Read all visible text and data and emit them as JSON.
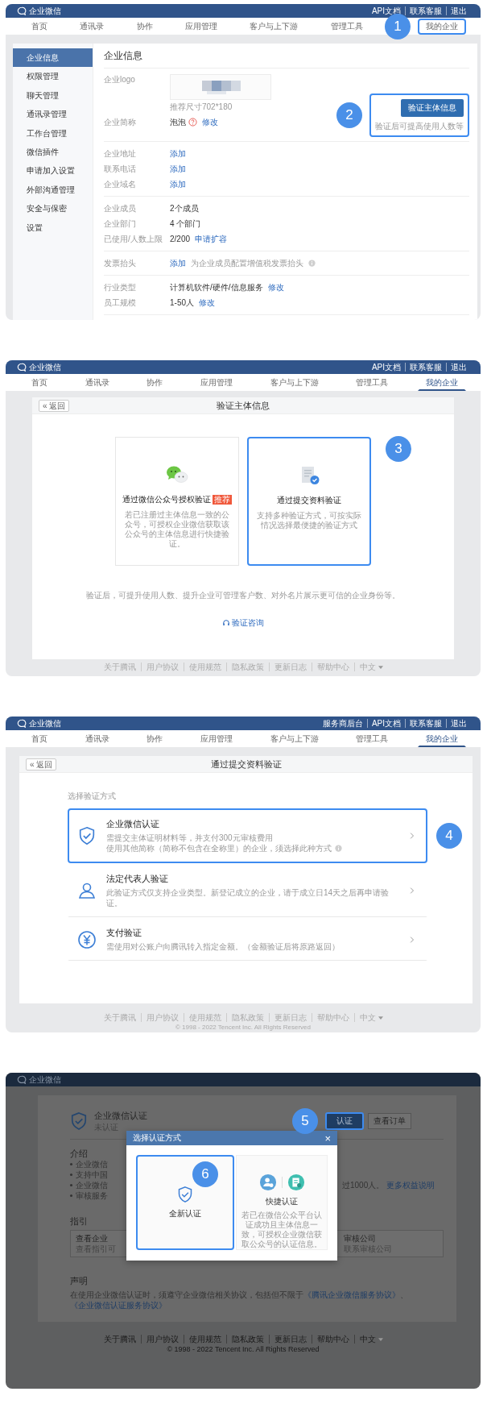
{
  "screens": [
    {
      "kind": "company_info",
      "brand": "企业微信",
      "top_links": [
        "API文档",
        "联系客服",
        "退出"
      ],
      "nav": [
        {
          "label": "首页",
          "selected": false,
          "highlighted": false
        },
        {
          "label": "通讯录",
          "selected": false,
          "highlighted": false
        },
        {
          "label": "协作",
          "selected": false,
          "highlighted": false
        },
        {
          "label": "应用管理",
          "selected": false,
          "highlighted": false
        },
        {
          "label": "客户与上下游",
          "selected": false,
          "highlighted": false
        },
        {
          "label": "管理工具",
          "selected": false,
          "highlighted": false
        },
        {
          "label": "我的企业",
          "selected": false,
          "highlighted": true,
          "step": "1"
        }
      ],
      "sidebar": [
        {
          "label": "企业信息",
          "selected": true
        },
        {
          "label": "权限管理",
          "selected": false
        },
        {
          "label": "聊天管理",
          "selected": false
        },
        {
          "label": "通讯录管理",
          "selected": false
        },
        {
          "label": "工作台管理",
          "selected": false
        },
        {
          "label": "微信插件",
          "selected": false
        },
        {
          "label": "申请加入设置",
          "selected": false
        },
        {
          "label": "外部沟通管理",
          "selected": false
        },
        {
          "label": "安全与保密",
          "selected": false
        },
        {
          "label": "设置",
          "selected": false
        }
      ],
      "title": "企业信息",
      "logo": {
        "label": "企业logo",
        "hint": "推荐尺寸702*180"
      },
      "short_name": {
        "label": "企业简称",
        "value": "泡泡",
        "link": "修改"
      },
      "verify": {
        "button": "验证主体信息",
        "note": "验证后可提高使用人数等",
        "highlighted": true,
        "step": "2"
      },
      "field_groups": [
        {
          "rows": [
            {
              "label": "企业地址",
              "link": "添加"
            },
            {
              "label": "联系电话",
              "link": "添加"
            },
            {
              "label": "企业域名",
              "link": "添加"
            }
          ]
        },
        {
          "rows": [
            {
              "label": "企业成员",
              "value": "2个成员"
            },
            {
              "label": "企业部门",
              "value": "4 个部门"
            },
            {
              "label": "已使用/人数上限",
              "value": "2/200",
              "link": "申请扩容"
            }
          ]
        },
        {
          "rows": [
            {
              "label": "发票抬头",
              "link": "添加",
              "note": "为企业成员配置增值税发票抬头"
            }
          ]
        },
        {
          "rows": [
            {
              "label": "行业类型",
              "value": "计算机软件/硬件/信息服务",
              "link": "修改"
            },
            {
              "label": "员工规模",
              "value": "1-50人",
              "link": "修改"
            }
          ]
        }
      ]
    },
    {
      "kind": "choose_verification",
      "brand": "企业微信",
      "top_links": [
        "API文档",
        "联系客服",
        "退出"
      ],
      "nav": [
        {
          "label": "首页",
          "selected": false,
          "highlighted": false
        },
        {
          "label": "通讯录",
          "selected": false,
          "highlighted": false
        },
        {
          "label": "协作",
          "selected": false,
          "highlighted": false
        },
        {
          "label": "应用管理",
          "selected": false,
          "highlighted": false
        },
        {
          "label": "客户与上下游",
          "selected": false,
          "highlighted": false
        },
        {
          "label": "管理工具",
          "selected": false,
          "highlighted": false
        },
        {
          "label": "我的企业",
          "selected": true,
          "highlighted": false
        }
      ],
      "back": "« 返回",
      "title": "验证主体信息",
      "options": [
        {
          "kind": "wechat",
          "title": "通过微信公众号授权验证",
          "tag": "推荐",
          "description": "若已注册过主体信息一致的公众号，可授权企业微信获取该公众号的主体信息进行快捷验证。",
          "highlighted": false
        },
        {
          "kind": "document",
          "title": "通过提交资料验证",
          "description": "支持多种验证方式，可按实际情况选择最便捷的验证方式",
          "highlighted": true,
          "step": "3"
        }
      ],
      "note": "验证后，可提升使用人数、提升企业可管理客户数、对外名片展示更可信的企业身份等。",
      "consult_link": "验证咨询",
      "footer_links": [
        "关于腾讯",
        "用户协议",
        "使用规范",
        "隐私政策",
        "更新日志",
        "帮助中心"
      ],
      "language": "中文"
    },
    {
      "kind": "choose_method",
      "brand": "企业微信",
      "top_links": [
        "服务商后台",
        "API文档",
        "联系客服",
        "退出"
      ],
      "nav": [
        {
          "label": "首页",
          "selected": false,
          "highlighted": false
        },
        {
          "label": "通讯录",
          "selected": false,
          "highlighted": false
        },
        {
          "label": "协作",
          "selected": false,
          "highlighted": false
        },
        {
          "label": "应用管理",
          "selected": false,
          "highlighted": false
        },
        {
          "label": "客户与上下游",
          "selected": false,
          "highlighted": false
        },
        {
          "label": "管理工具",
          "selected": false,
          "highlighted": false
        },
        {
          "label": "我的企业",
          "selected": true,
          "highlighted": false
        }
      ],
      "back": "« 返回",
      "title": "通过提交资料验证",
      "section_label": "选择验证方式",
      "methods": [
        {
          "kind": "shield",
          "title": "企业微信认证",
          "lines": [
            "需提交主体证明材料等，并支付300元审核费用",
            "使用其他简称（简称不包含在全称里）的企业，须选择此种方式"
          ],
          "info": true,
          "highlighted": true,
          "step": "4"
        },
        {
          "kind": "person",
          "title": "法定代表人验证",
          "lines": [
            "此验证方式仅支持企业类型。新登记成立的企业，请于成立日14天之后再申请验证。"
          ],
          "info": false,
          "highlighted": false
        },
        {
          "kind": "yuan",
          "title": "支付验证",
          "lines": [
            "需使用对公账户向腾讯转入指定金额。（金额验证后将原路返回）"
          ],
          "info": false,
          "highlighted": false
        }
      ],
      "footer_links": [
        "关于腾讯",
        "用户协议",
        "使用规范",
        "隐私政策",
        "更新日志",
        "帮助中心"
      ],
      "language": "中文",
      "copyright": "© 1998 - 2022 Tencent Inc. All Rights Reserved"
    },
    {
      "kind": "certification",
      "brand": "企业微信",
      "title": "企业微信认证",
      "status": "未认证",
      "action": {
        "label": "认证",
        "highlighted": true,
        "step": "5"
      },
      "orders_button": "查看订单",
      "intro": {
        "heading": "介绍",
        "bullets": [
          {
            "text": "企业微信"
          },
          {
            "text": "支持中国"
          },
          {
            "text": "企业微信",
            "tail": "过1000人。",
            "tail_link": "更多权益说明"
          },
          {
            "text": "审核服务"
          }
        ]
      },
      "guide": {
        "heading": "指引",
        "cards": [
          {
            "title": "查看企业",
            "text": "查看指引可"
          },
          {
            "title": "审核公司",
            "text": "联系审核公司"
          }
        ]
      },
      "statement": {
        "heading": "声明",
        "text": "在使用企业微信认证时，须遵守企业微信相关协议，包括但不限于",
        "links": [
          "《腾讯企业微信服务协议》",
          "《企业微信认证服务协议》"
        ],
        "separator": "、"
      },
      "footer_links": [
        "关于腾讯",
        "用户协议",
        "使用规范",
        "隐私政策",
        "更新日志",
        "帮助中心"
      ],
      "language": "中文",
      "copyright": "© 1998 - 2022 Tencent Inc. All Rights Reserved",
      "modal": {
        "title": "选择认证方式",
        "close": "×",
        "options": [
          {
            "kind": "new",
            "label": "全新认证",
            "highlighted": true,
            "step": "6"
          },
          {
            "kind": "quick",
            "label": "快捷认证",
            "description": "若已在微信公众平台认证成功且主体信息一致，可授权企业微信获取公众号的认证信息。",
            "highlighted": false
          }
        ]
      }
    }
  ]
}
